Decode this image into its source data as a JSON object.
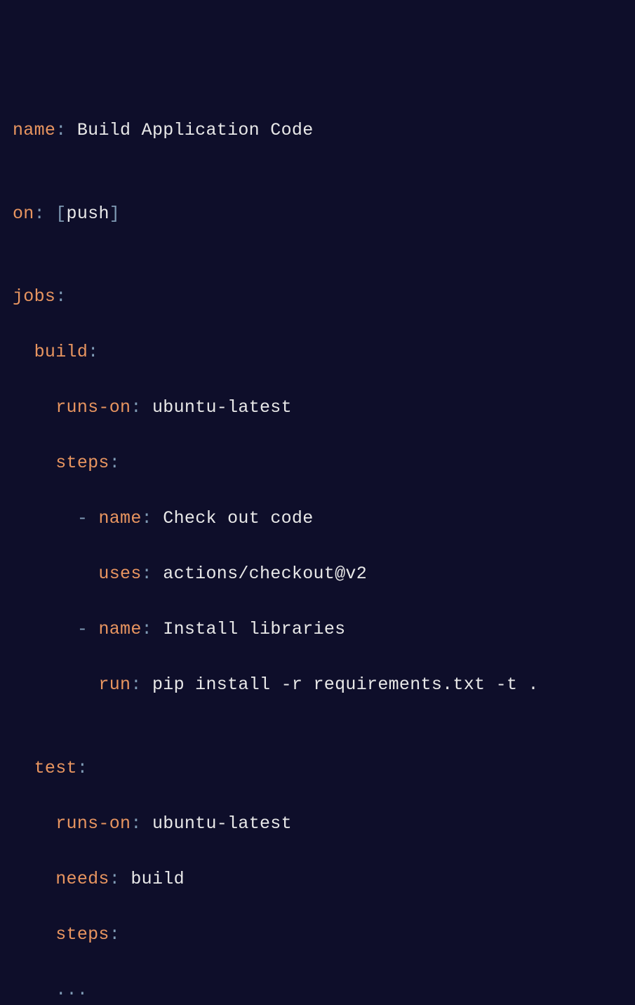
{
  "keys": {
    "name": "name",
    "on": "on",
    "jobs": "jobs",
    "build": "build",
    "runs_on": "runs-on",
    "steps": "steps",
    "uses": "uses",
    "run": "run",
    "test": "test",
    "needs": "needs"
  },
  "punct": {
    "colon": ":",
    "lbracket": "[",
    "rbracket": "]",
    "dash": "-"
  },
  "values": {
    "workflow_name": "Build Application Code",
    "on_event": "push",
    "ubuntu": "ubuntu-latest",
    "step1_name": "Check out code",
    "step1_uses": "actions/checkout@v2",
    "step2_name": "Install libraries",
    "step2_run": "pip install -r requirements.txt -t .",
    "needs_build": "build",
    "ellipsis": "..."
  }
}
